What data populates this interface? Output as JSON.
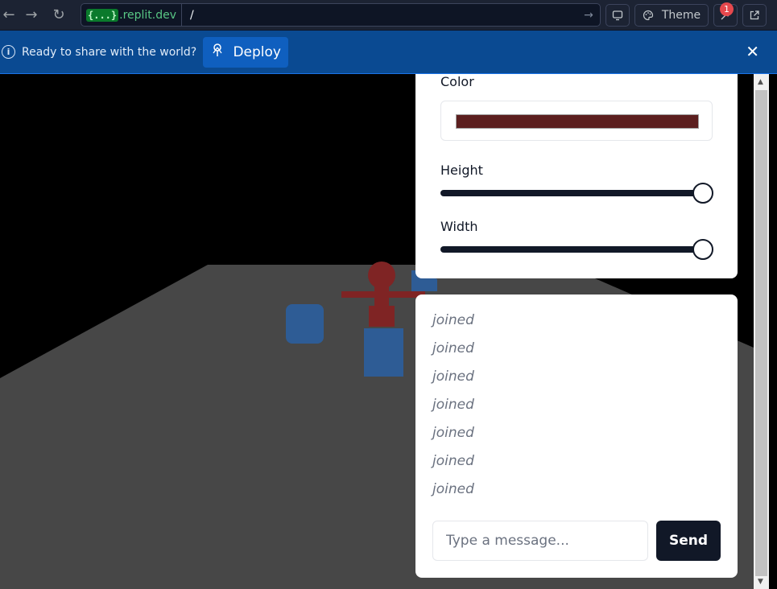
{
  "browser": {
    "url_tag": "{...}",
    "url_host": ".replit.dev",
    "url_path": "/",
    "theme_label": "Theme",
    "devtools_badge": "1"
  },
  "banner": {
    "message": "Ready to share with the world?",
    "deploy_label": "Deploy"
  },
  "controls": {
    "color_label": "Color",
    "color_value": "#5c1f1f",
    "height_label": "Height",
    "height_level": 1.0,
    "width_label": "Width",
    "width_level": 1.0
  },
  "chat": {
    "messages": [
      "joined",
      "joined",
      "joined",
      "joined",
      "joined",
      "joined",
      "joined"
    ],
    "input_placeholder": "Type a message...",
    "send_label": "Send"
  }
}
